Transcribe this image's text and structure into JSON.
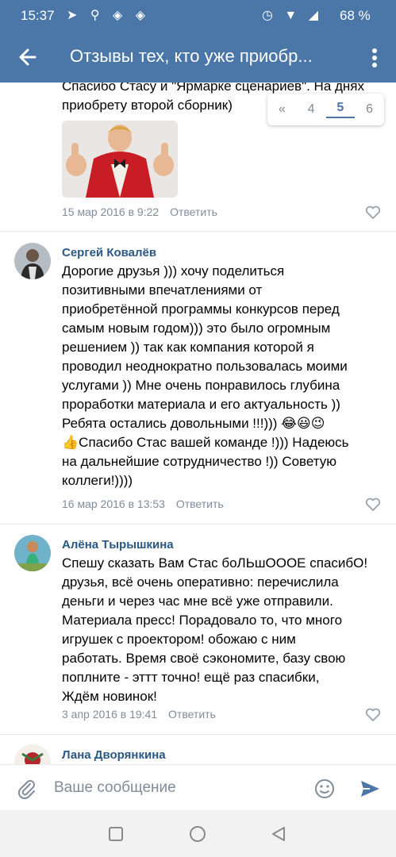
{
  "status_bar": {
    "time": "15:37",
    "battery": "68 %"
  },
  "header": {
    "title": "Отзывы тех, кто уже приобр..."
  },
  "pager": {
    "prev": "«",
    "pages": [
      "4",
      "5",
      "6"
    ],
    "current": "5"
  },
  "comments": [
    {
      "text_lines": [
        "Спасибо Стасу и \"Ярмарке сценариев\". На днях",
        "приобрету второй сборник)"
      ],
      "date": "15 мар 2016 в 9:22",
      "reply": "Ответить"
    },
    {
      "author": "Сергей Ковалёв",
      "text_lines": [
        "Дорогие друзья ))) хочу поделиться",
        "позитивными впечатлениями от",
        "приобретённой программы конкурсов перед",
        "самым новым годом))) это было огромным",
        "решением )) так как компания которой я",
        "проводил неоднократно пользовалась моими",
        "услугами )) Мне очень понравилось глубина",
        "проработки материала и его актуальность ))",
        "Ребята остались довольными !!!))) 😂😃😉",
        "👍Спасибо Стас вашей команде !))) Надеюсь",
        "на дальнейшие сотрудничество !)) Советую",
        "коллеги!))))"
      ],
      "date": "16 мар 2016 в 13:53",
      "reply": "Ответить"
    },
    {
      "author": "Алёна Тырышкина",
      "text_lines": [
        "Спешу сказать Вам Стас боЛЬшОООЕ спасибО!",
        "друзья, всё очень оперативно: перечислила",
        "деньги и через час мне всё уже отправили.",
        "Материала пресс! Порадовало то, что много",
        "игрушек с проектором! обожаю с ним",
        "работать. Время своё сэкономите, базу свою",
        "поплните - эттт точно! ещё раз спасибки,",
        "Ждём новинок!"
      ],
      "date": "3 апр 2016 в 19:41",
      "reply": "Ответить"
    },
    {
      "author": "Лана Дворянкина"
    }
  ],
  "composer": {
    "placeholder": "Ваше сообщение"
  },
  "colors": {
    "header": "#4a76a8",
    "link": "#2a5885",
    "meta": "#818c99",
    "accent": "#4a76a8"
  }
}
